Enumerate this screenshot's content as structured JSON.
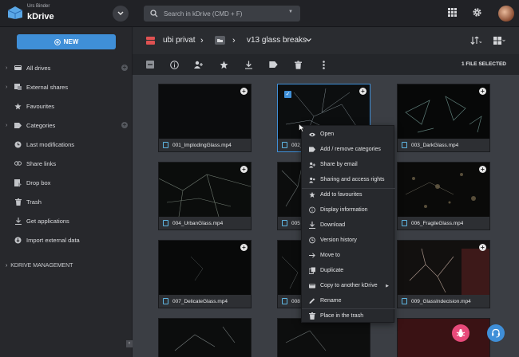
{
  "header": {
    "user_name": "Urs Binder",
    "app_name": "kDrive",
    "search_placeholder": "Search in kDrive (CMD + F)"
  },
  "sidebar": {
    "new_label": "NEW",
    "items": [
      {
        "label": "All drives"
      },
      {
        "label": "External shares"
      },
      {
        "label": "Favourites"
      },
      {
        "label": "Categories"
      },
      {
        "label": "Last modifications"
      },
      {
        "label": "Share links"
      },
      {
        "label": "Drop box"
      },
      {
        "label": "Trash"
      },
      {
        "label": "Get applications"
      },
      {
        "label": "Import external data"
      }
    ],
    "management_label": "KDRIVE MANAGEMENT"
  },
  "breadcrumb": {
    "drive": "ubi privat",
    "folder": "v13 glass breaks"
  },
  "toolbar": {
    "selection_count": "1 FILE SELECTED"
  },
  "files": [
    {
      "name": "001_ImplodingGlass.mp4"
    },
    {
      "name": "002_"
    },
    {
      "name": "003_DarkGlass.mp4"
    },
    {
      "name": "004_UrbanGlass.mp4"
    },
    {
      "name": "005"
    },
    {
      "name": "006_FragileGlass.mp4"
    },
    {
      "name": "007_DelicateGlass.mp4"
    },
    {
      "name": "008"
    },
    {
      "name": "009_GlassIndecision.mp4"
    }
  ],
  "context_menu": {
    "items": [
      {
        "label": "Open"
      },
      {
        "label": "Add / remove categories"
      },
      {
        "label": "Share by email"
      },
      {
        "label": "Sharing and access rights"
      },
      {
        "label": "Add to favourites"
      },
      {
        "label": "Display information"
      },
      {
        "label": "Download"
      },
      {
        "label": "Version history"
      },
      {
        "label": "Move to"
      },
      {
        "label": "Duplicate"
      },
      {
        "label": "Copy to another kDrive"
      },
      {
        "label": "Rename"
      },
      {
        "label": "Place in the trash"
      }
    ]
  },
  "colors": {
    "accent": "#3f8fd8",
    "video_icon": "#5fb7e3",
    "bug_fab": "#e84a7a",
    "support_fab": "#3f8fd8"
  }
}
